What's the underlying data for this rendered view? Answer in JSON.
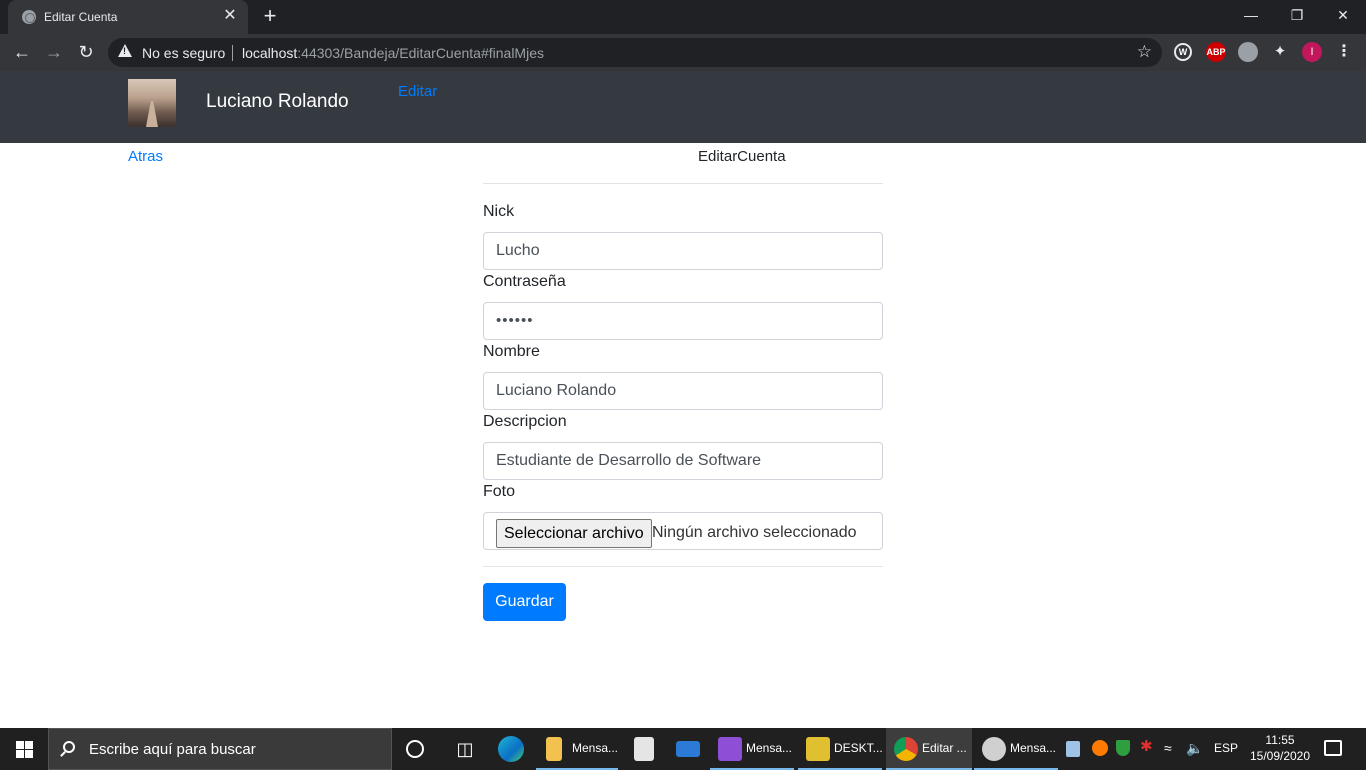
{
  "browser": {
    "tab_title": "Editar Cuenta",
    "tab_close": "✕",
    "new_tab": "+",
    "security_label": "No es seguro",
    "url_host": "localhost",
    "url_rest": ":44303/Bandeja/EditarCuenta#finalMjes",
    "extensions": [
      {
        "name": "w-extension-icon",
        "text": "W"
      },
      {
        "name": "adblock-icon",
        "text": "ABP"
      },
      {
        "name": "gray-extension-icon",
        "text": ""
      },
      {
        "name": "puzzle-extensions-icon",
        "text": ""
      },
      {
        "name": "profile-avatar",
        "text": "I"
      }
    ]
  },
  "navbar": {
    "user_name": "Luciano Rolando",
    "link_edit": "Editar"
  },
  "page": {
    "back_link": "Atras",
    "heading": "EditarCuenta"
  },
  "form": {
    "nick_label": "Nick",
    "nick_value": "Lucho",
    "password_label": "Contraseña",
    "password_value": "••••••",
    "name_label": "Nombre",
    "name_value": "Luciano Rolando",
    "description_label": "Descripcion",
    "description_value": "Estudiante de Desarrollo de Software",
    "photo_label": "Foto",
    "file_button": "Seleccionar archivo",
    "file_status": "Ningún archivo seleccionado",
    "save_button": "Guardar"
  },
  "taskbar": {
    "search_placeholder": "Escribe aquí para buscar",
    "apps": [
      {
        "label": "Mensa...",
        "icon": "folder-icon",
        "color": "#f2c14e"
      },
      {
        "label": "",
        "icon": "store-icon",
        "color": "#cccccc"
      },
      {
        "label": "",
        "icon": "mail-icon",
        "color": "#2a7ad6"
      },
      {
        "label": "Mensa...",
        "icon": "visual-studio-icon",
        "color": "#8e4fd6"
      },
      {
        "label": "DESKT...",
        "icon": "sql-icon",
        "color": "#e0c030"
      },
      {
        "label": "Editar ...",
        "icon": "chrome-icon",
        "color": "#4285f4"
      },
      {
        "label": "Mensa...",
        "icon": "paint-icon",
        "color": "#d0d0d0"
      }
    ],
    "language": "ESP",
    "time": "11:55",
    "date": "15/09/2020"
  }
}
